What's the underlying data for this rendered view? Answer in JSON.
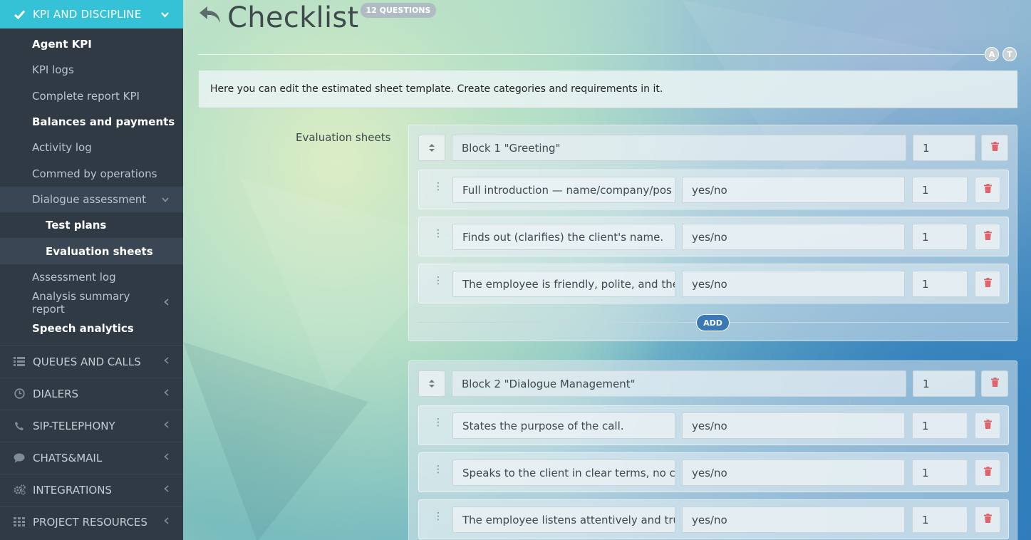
{
  "sidebar": {
    "active_section": "KPI AND DISCIPLINE",
    "items": [
      {
        "label": "Agent KPI"
      },
      {
        "label": "KPI logs"
      },
      {
        "label": "Complete report KPI"
      },
      {
        "label": "Balances and payments"
      },
      {
        "label": "Activity log"
      },
      {
        "label": "Commed by operations"
      },
      {
        "label": "Dialogue assessment"
      },
      {
        "label": "Test plans"
      },
      {
        "label": "Evaluation sheets"
      },
      {
        "label": "Assessment log"
      },
      {
        "label": "Analysis summary report"
      },
      {
        "label": "Speech analytics"
      }
    ],
    "groups": [
      {
        "label": "QUEUES AND CALLS",
        "icon": "list-icon"
      },
      {
        "label": "DIALERS",
        "icon": "clock-icon"
      },
      {
        "label": "SIP-TELEPHONY",
        "icon": "phone-icon"
      },
      {
        "label": "CHATS&MAIL",
        "icon": "chat-icon"
      },
      {
        "label": "INTEGRATIONS",
        "icon": "gears-icon"
      },
      {
        "label": "PROJECT RESOURCES",
        "icon": "grid-icon"
      }
    ]
  },
  "header": {
    "title": "Checklist",
    "badge": "12 QUESTIONS",
    "btn_a": "A",
    "btn_t": "T"
  },
  "info_text": "Here you can edit the estimated sheet template. Create categories and requirements in it.",
  "sheet_label": "Evaluation sheets",
  "blocks": [
    {
      "name": "Block 1 \"Greeting\"",
      "weight": "1",
      "add_label": "ADD",
      "questions": [
        {
          "text": "Full introduction — name/company/pos",
          "type": "yes/no",
          "weight": "1"
        },
        {
          "text": "Finds out (clarifies) the client's name.",
          "type": "yes/no",
          "weight": "1"
        },
        {
          "text": "The employee is friendly, polite, and the",
          "type": "yes/no",
          "weight": "1"
        }
      ]
    },
    {
      "name": "Block 2 \"Dialogue Management\"",
      "weight": "1",
      "questions": [
        {
          "text": "States the purpose of the call.",
          "type": "yes/no",
          "weight": "1"
        },
        {
          "text": "Speaks to the client in clear terms, no cc",
          "type": "yes/no",
          "weight": "1"
        },
        {
          "text": "The employee listens attentively and tru",
          "type": "yes/no",
          "weight": "1"
        }
      ]
    }
  ]
}
